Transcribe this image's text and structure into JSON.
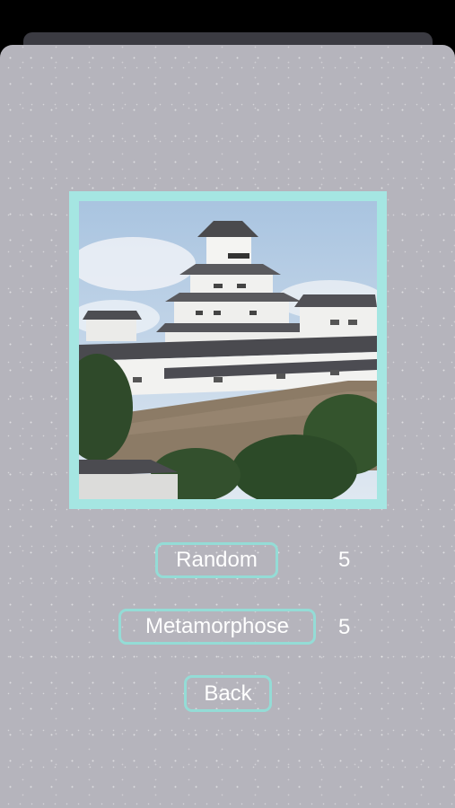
{
  "image": {
    "subject": "castle-photo"
  },
  "actions": {
    "random_label": "Random",
    "random_count": "5",
    "metamorphose_label": "Metamorphose",
    "metamorphose_count": "5",
    "back_label": "Back"
  },
  "colors": {
    "accent": "#a5e6e2",
    "button_border": "#94dcd6",
    "sheet_background": "#b5b4bc",
    "text": "#ffffff"
  }
}
